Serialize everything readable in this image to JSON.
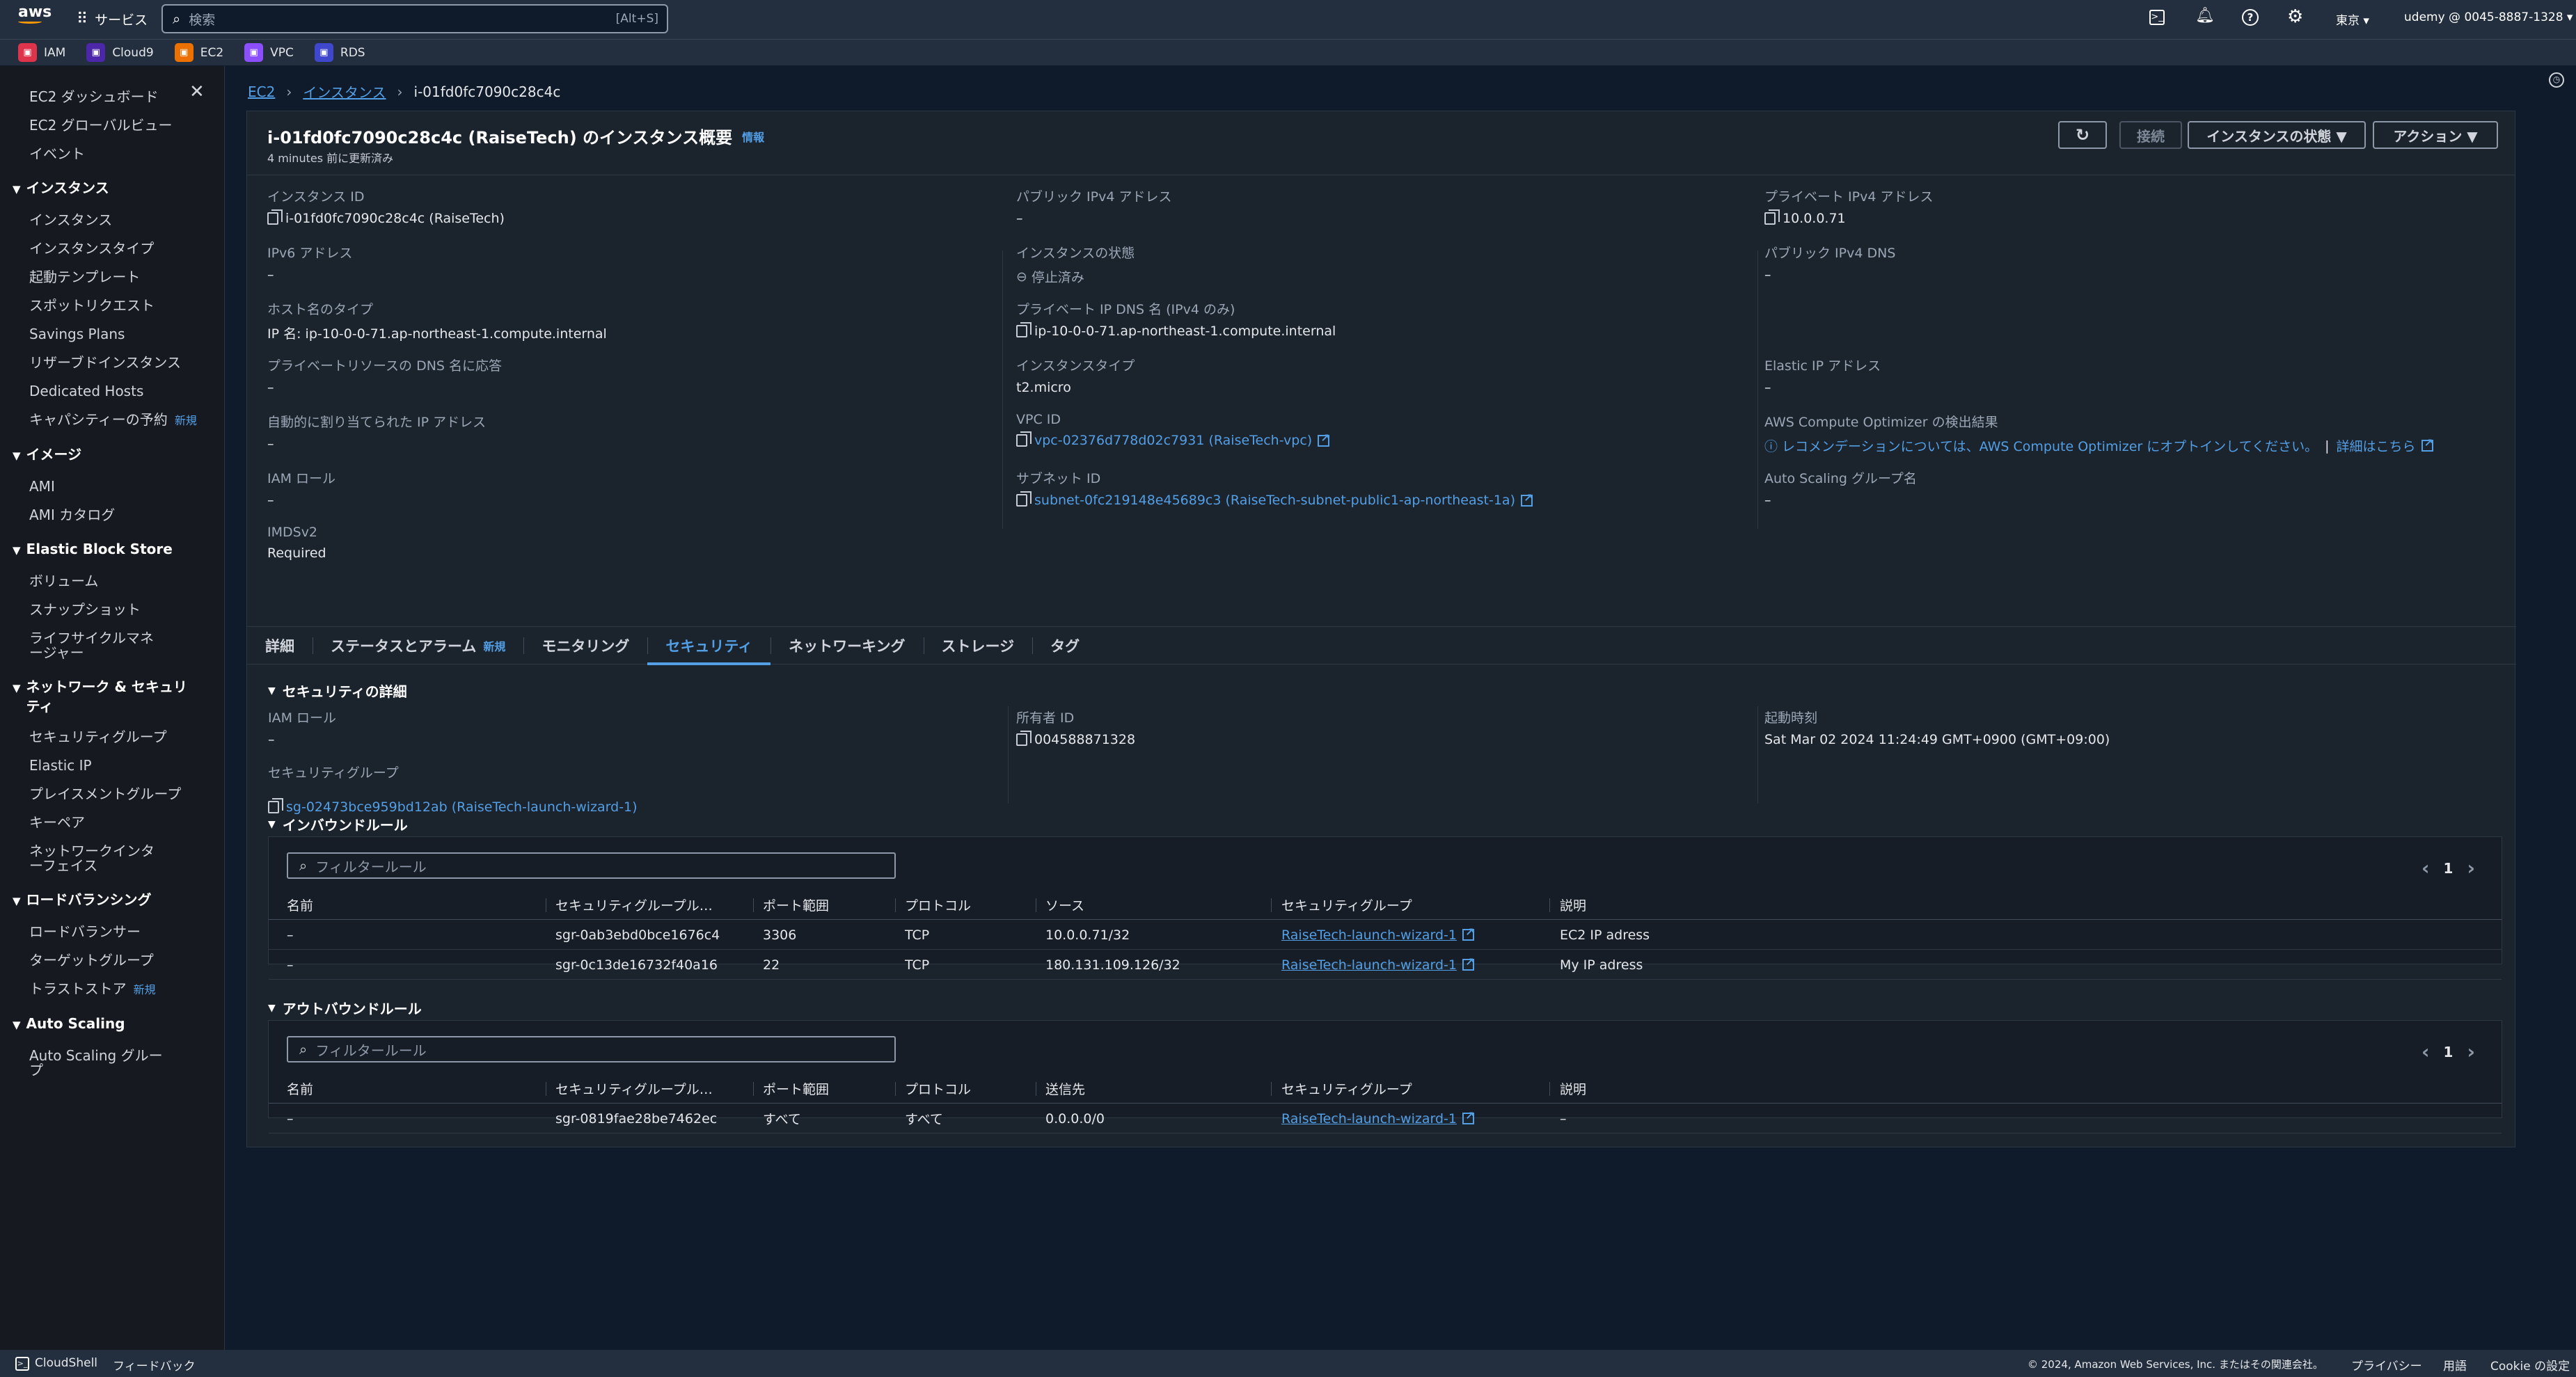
{
  "topbar": {
    "logo": "aws",
    "services": "サービス",
    "search_placeholder": "検索",
    "search_shortcut": "[Alt+S]",
    "region": "東京 ▾",
    "account": "udemy @ 0045-8887-1328 ▾"
  },
  "favorites": [
    {
      "label": "IAM",
      "color": "#dd344c"
    },
    {
      "label": "Cloud9",
      "color": "#4d27aa"
    },
    {
      "label": "EC2",
      "color": "#ed7100"
    },
    {
      "label": "VPC",
      "color": "#8c4fff"
    },
    {
      "label": "RDS",
      "color": "#3f48cc"
    }
  ],
  "sidebar": {
    "top": [
      "EC2 ダッシュボード",
      "EC2 グローバルビュー",
      "イベント"
    ],
    "sections": [
      {
        "title": "インスタンス",
        "items": [
          "インスタンス",
          "インスタンスタイプ",
          "起動テンプレート",
          "スポットリクエスト",
          "Savings Plans",
          "リザーブドインスタンス",
          "Dedicated Hosts",
          "キャパシティーの予約"
        ]
      },
      {
        "title": "イメージ",
        "items": [
          "AMI",
          "AMI カタログ"
        ]
      },
      {
        "title": "Elastic Block Store",
        "items": [
          "ボリューム",
          "スナップショット",
          "ライフサイクルマネージャー"
        ]
      },
      {
        "title": "ネットワーク & セキュリティ",
        "items": [
          "セキュリティグループ",
          "Elastic IP",
          "プレイスメントグループ",
          "キーペア",
          "ネットワークインターフェイス"
        ]
      },
      {
        "title": "ロードバランシング",
        "items": [
          "ロードバランサー",
          "ターゲットグループ",
          "トラストストア"
        ]
      },
      {
        "title": "Auto Scaling",
        "items": [
          "Auto Scaling グループ"
        ]
      }
    ],
    "new_badge": "新規"
  },
  "breadcrumb": {
    "ec2": "EC2",
    "instances": "インスタンス",
    "current": "i-01fd0fc7090c28c4c"
  },
  "summary": {
    "title": "i-01fd0fc7090c28c4c (RaiseTech) のインスタンス概要",
    "info": "情報",
    "updated": "4 minutes 前に更新済み",
    "buttons": {
      "connect": "接続",
      "state": "インスタンスの状態 ▼",
      "actions": "アクション ▼"
    },
    "col1": [
      {
        "label": "インスタンス ID",
        "value": "i-01fd0fc7090c28c4c (RaiseTech)"
      },
      {
        "label": "IPv6 アドレス",
        "value": "–"
      },
      {
        "label": "ホスト名のタイプ",
        "value": "IP 名: ip-10-0-0-71.ap-northeast-1.compute.internal"
      },
      {
        "label": "プライベートリソースの DNS 名に応答",
        "value": "–"
      },
      {
        "label": "自動的に割り当てられた IP アドレス",
        "value": "–"
      },
      {
        "label": "IAM ロール",
        "value": "–"
      },
      {
        "label": "IMDSv2",
        "value": "Required"
      }
    ],
    "col2": [
      {
        "label": "パブリック IPv4 アドレス",
        "value": "–"
      },
      {
        "label": "インスタンスの状態",
        "value": "停止済み"
      },
      {
        "label": "プライベート IP DNS 名 (IPv4 のみ)",
        "value": "ip-10-0-0-71.ap-northeast-1.compute.internal"
      },
      {
        "label": "インスタンスタイプ",
        "value": "t2.micro"
      },
      {
        "label": "VPC ID",
        "value": "vpc-02376d778d02c7931 (RaiseTech-vpc)"
      },
      {
        "label": "サブネット ID",
        "value": "subnet-0fc219148e45689c3 (RaiseTech-subnet-public1-ap-northeast-1a)"
      }
    ],
    "col3": [
      {
        "label": "プライベート IPv4 アドレス",
        "value": "10.0.0.71"
      },
      {
        "label": "パブリック IPv4 DNS",
        "value": "–"
      },
      {
        "label": "Elastic IP アドレス",
        "value": "–"
      },
      {
        "label": "AWS Compute Optimizer の検出結果",
        "value": "レコメンデーションについては、AWS Compute Optimizer にオプトインしてください。",
        "value2": "詳細はこちら"
      },
      {
        "label": "Auto Scaling グループ名",
        "value": "–"
      }
    ]
  },
  "tabs": [
    {
      "label": "詳細"
    },
    {
      "label": "ステータスとアラーム",
      "badge": "新規"
    },
    {
      "label": "モニタリング"
    },
    {
      "label": "セキュリティ"
    },
    {
      "label": "ネットワーキング"
    },
    {
      "label": "ストレージ"
    },
    {
      "label": "タグ"
    }
  ],
  "security": {
    "heading": "セキュリティの詳細",
    "iam_label": "IAM ロール",
    "iam_value": "–",
    "sg_label": "セキュリティグループ",
    "sg_value": "sg-02473bce959bd12ab (RaiseTech-launch-wizard-1)",
    "owner_label": "所有者 ID",
    "owner_value": "004588871328",
    "launch_label": "起動時刻",
    "launch_value": "Sat Mar 02 2024 11:24:49 GMT+0900 (GMT+09:00)"
  },
  "inbound": {
    "heading": "インバウンドルール",
    "filter": "フィルタールール",
    "page": "1",
    "columns": [
      "名前",
      "セキュリティグループル…",
      "ポート範囲",
      "プロトコル",
      "ソース",
      "セキュリティグループ",
      "説明"
    ],
    "rows": [
      [
        "–",
        "sgr-0ab3ebd0bce1676c4",
        "3306",
        "TCP",
        "10.0.0.71/32",
        "RaiseTech-launch-wizard-1",
        "EC2 IP adress"
      ],
      [
        "–",
        "sgr-0c13de16732f40a16",
        "22",
        "TCP",
        "180.131.109.126/32",
        "RaiseTech-launch-wizard-1",
        "My IP adress"
      ]
    ]
  },
  "outbound": {
    "heading": "アウトバウンドルール",
    "filter": "フィルタールール",
    "page": "1",
    "columns": [
      "名前",
      "セキュリティグループル…",
      "ポート範囲",
      "プロトコル",
      "送信先",
      "セキュリティグループ",
      "説明"
    ],
    "rows": [
      [
        "–",
        "sgr-0819fae28be7462ec",
        "すべて",
        "すべて",
        "0.0.0.0/0",
        "RaiseTech-launch-wizard-1",
        "–"
      ]
    ]
  },
  "footer": {
    "cloudshell": "CloudShell",
    "feedback": "フィードバック",
    "copyright": "© 2024, Amazon Web Services, Inc. またはその関連会社。",
    "privacy": "プライバシー",
    "terms": "用語",
    "cookie": "Cookie の設定"
  }
}
